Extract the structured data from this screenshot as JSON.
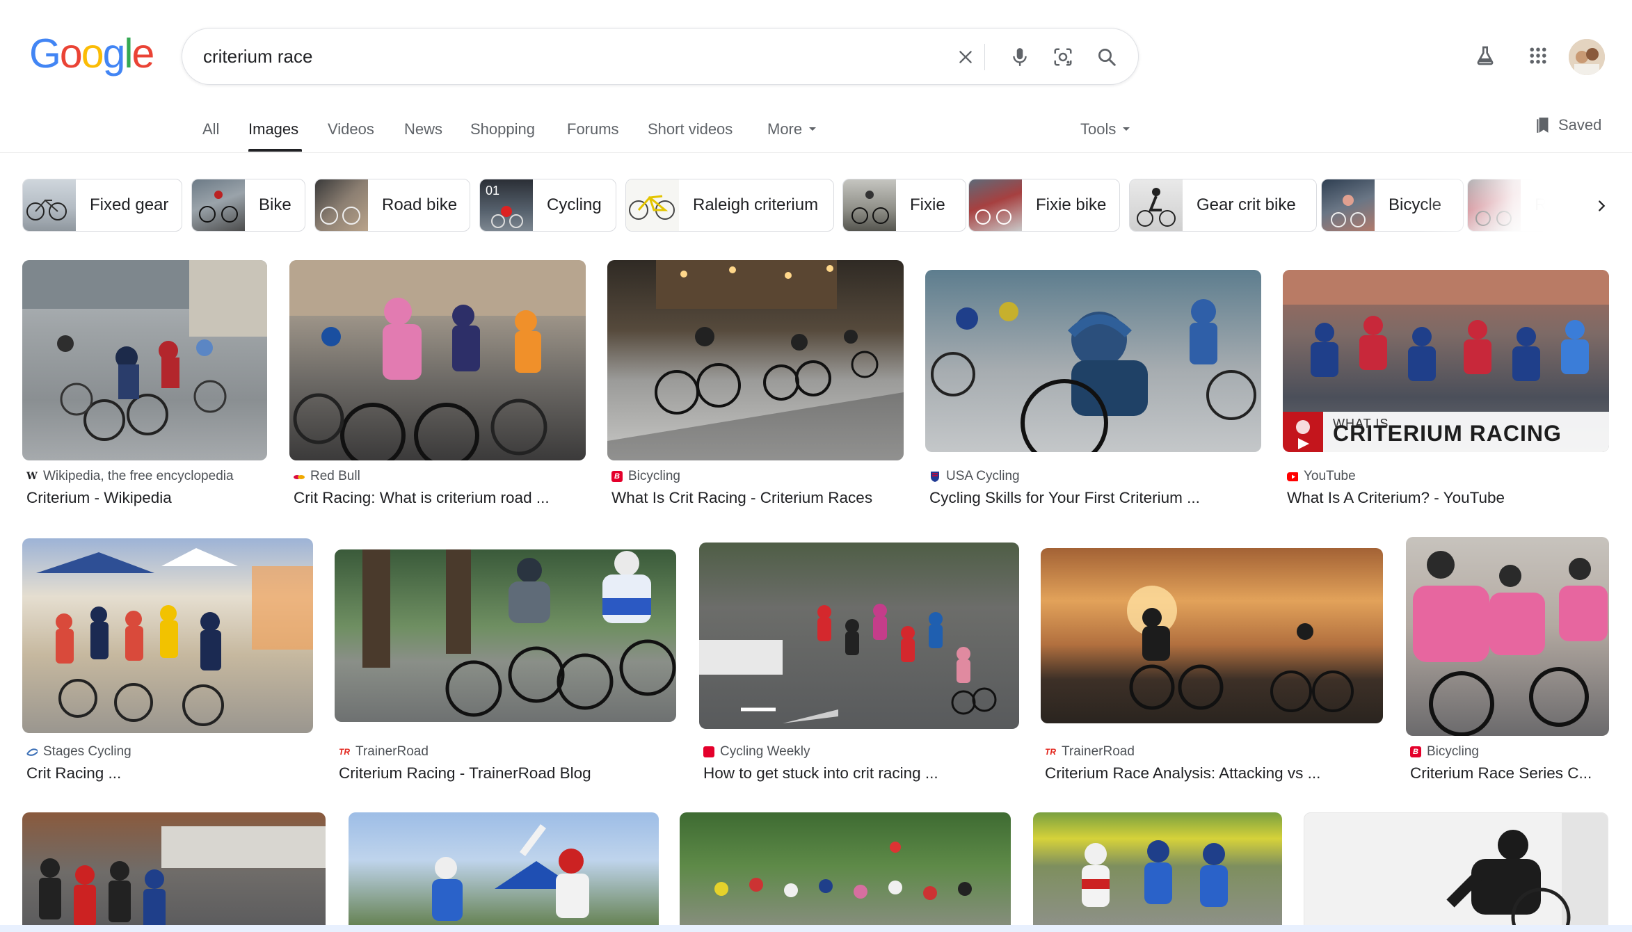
{
  "logo": {
    "letters": [
      "G",
      "o",
      "o",
      "g",
      "l",
      "e"
    ],
    "colors": [
      "#4285F4",
      "#EA4335",
      "#FBBC05",
      "#4285F4",
      "#34A853",
      "#EA4335"
    ]
  },
  "search": {
    "query": "criterium race",
    "clear_icon": "close-icon",
    "voice_icon": "mic-icon",
    "lens_icon": "lens-icon",
    "search_icon": "search-icon"
  },
  "header_icons": {
    "labs": "flask-icon",
    "apps": "apps-grid-icon",
    "account": "avatar"
  },
  "tabs": {
    "all": "All",
    "images": "Images",
    "videos": "Videos",
    "news": "News",
    "shopping": "Shopping",
    "forums": "Forums",
    "short_videos": "Short videos",
    "more": "More",
    "tools": "Tools"
  },
  "saved_label": "Saved",
  "chips": [
    "Fixed gear",
    "Bike",
    "Road bike",
    "Cycling",
    "Raleigh criterium",
    "Fixie",
    "Fixie bike",
    "Gear crit bike",
    "Bicycle",
    "Road r"
  ],
  "results": [
    {
      "source": "Wikipedia, the free encyclopedia",
      "title": "Criterium - Wikipedia",
      "favicon": "W",
      "favicon_color": "#ffffff"
    },
    {
      "source": "Red Bull",
      "title": "Crit Racing: What is criterium road ...",
      "favicon": "",
      "favicon_color": "#db0a40"
    },
    {
      "source": "Bicycling",
      "title": "What Is Crit Racing - Criterium Races",
      "favicon": "B",
      "favicon_color": "#e4002b"
    },
    {
      "source": "USA Cycling",
      "title": "Cycling Skills for Your First Criterium ...",
      "favicon": "",
      "favicon_color": "#1f3a93"
    },
    {
      "source": "YouTube",
      "title": "What Is A Criterium? - YouTube",
      "favicon": "",
      "favicon_color": "#ff0000",
      "overlay_small": "WHAT IS...",
      "overlay_big": "CRITERIUM RACING"
    },
    {
      "source": "Stages Cycling",
      "title": "Crit Racing ...",
      "favicon": "",
      "favicon_color": "#3b6fb6"
    },
    {
      "source": "TrainerRoad",
      "title": "Criterium Racing - TrainerRoad Blog",
      "favicon": "TR",
      "favicon_color": "#e2231a"
    },
    {
      "source": "Cycling Weekly",
      "title": "How to get stuck into crit racing ...",
      "favicon": "",
      "favicon_color": "#e4002b"
    },
    {
      "source": "TrainerRoad",
      "title": "Criterium Race Analysis: Attacking vs ...",
      "favicon": "TR",
      "favicon_color": "#e2231a"
    },
    {
      "source": "Bicycling",
      "title": "Criterium Race Series C...",
      "favicon": "B",
      "favicon_color": "#e4002b"
    }
  ]
}
